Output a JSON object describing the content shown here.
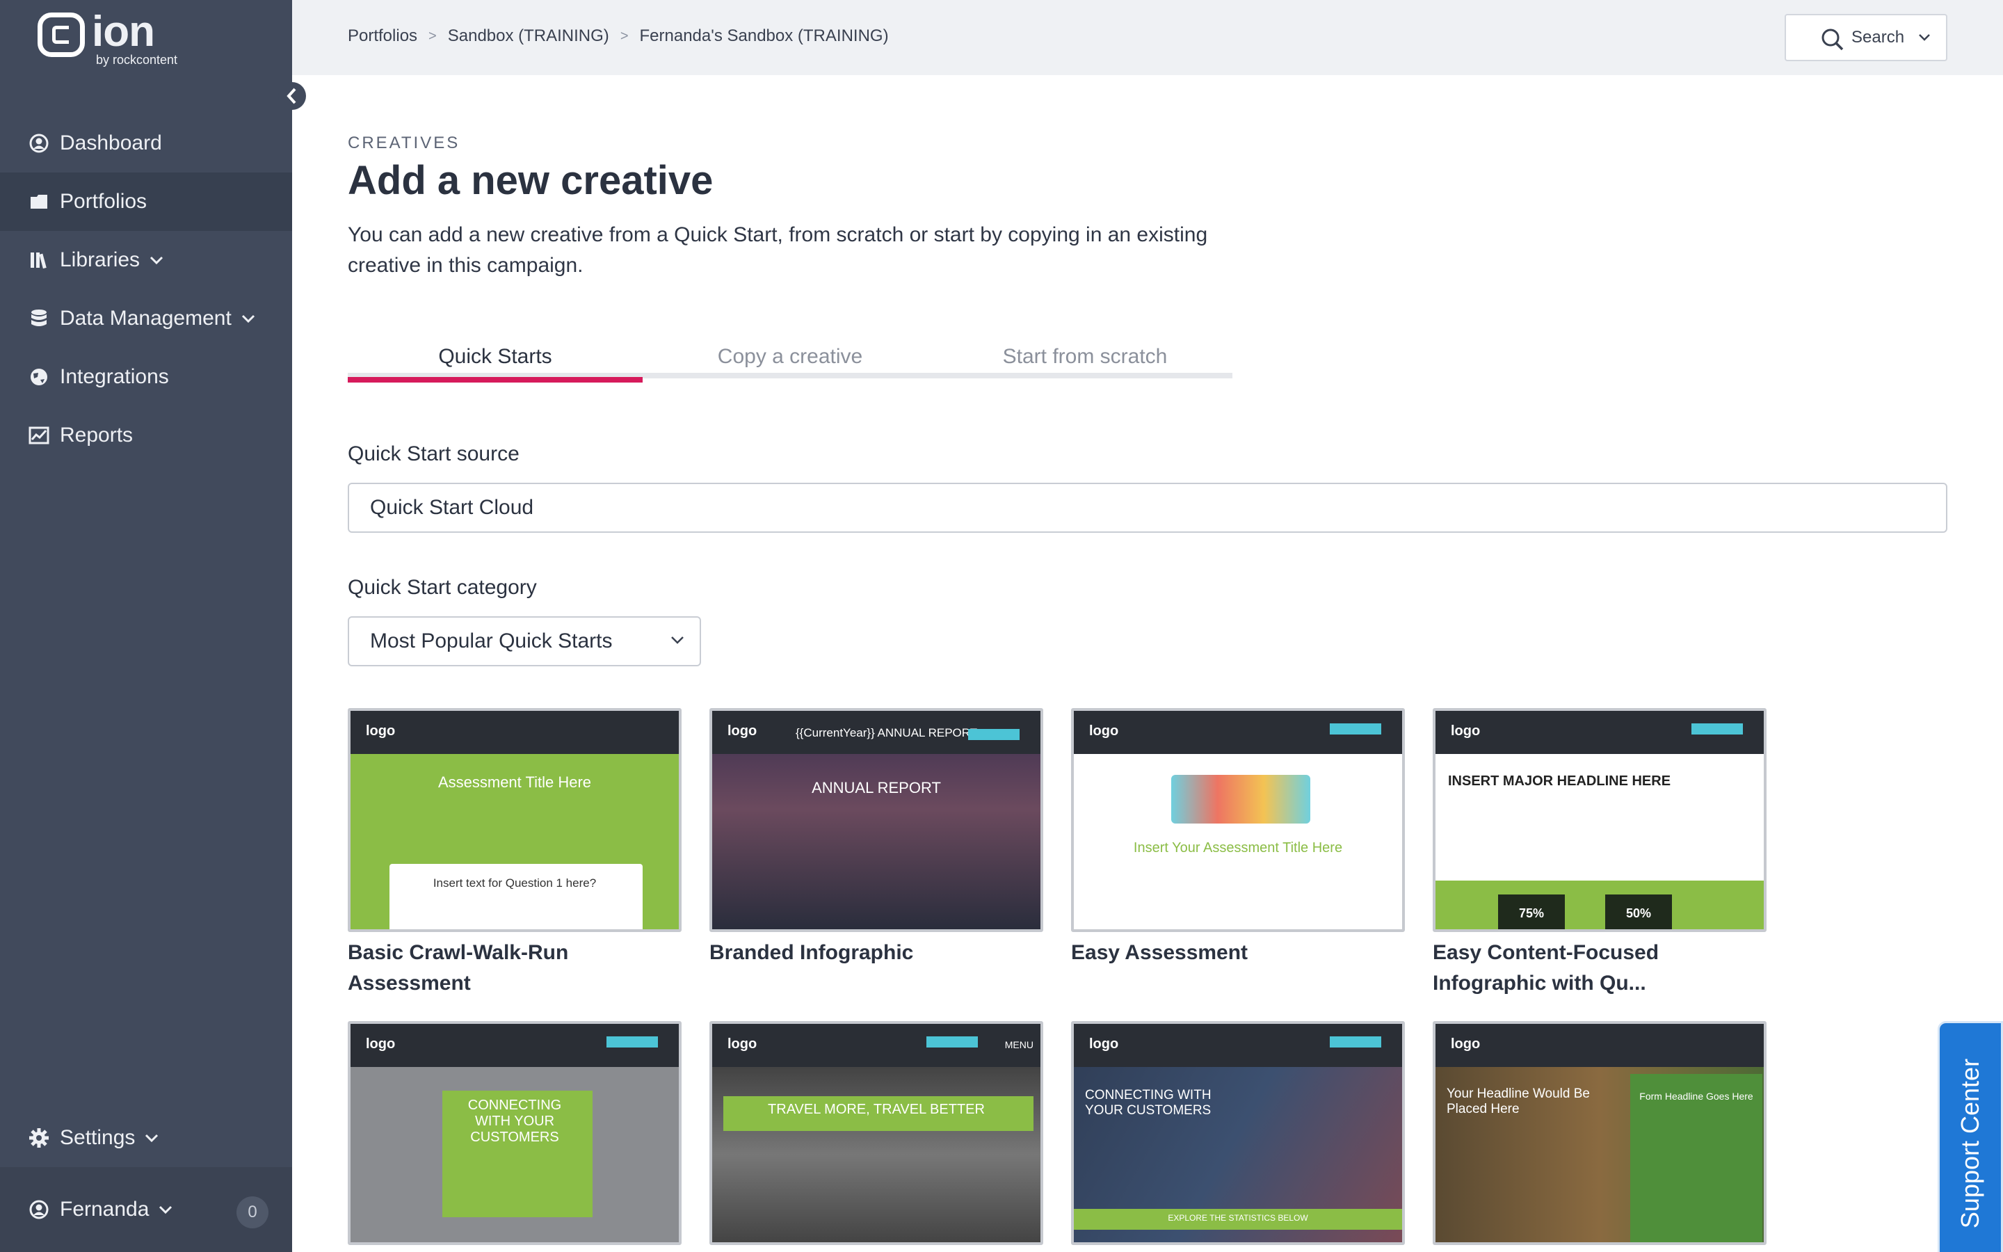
{
  "brand": {
    "name": "ion",
    "sub": "by rockcontent"
  },
  "nav": {
    "items": [
      {
        "label": "Dashboard",
        "icon": "user-circle-icon"
      },
      {
        "label": "Portfolios",
        "icon": "folder-icon"
      },
      {
        "label": "Libraries",
        "icon": "library-icon"
      },
      {
        "label": "Data Management",
        "icon": "database-icon"
      },
      {
        "label": "Integrations",
        "icon": "globe-icon"
      },
      {
        "label": "Reports",
        "icon": "chart-icon"
      }
    ],
    "settings": "Settings",
    "user": "Fernanda",
    "notifications": "0"
  },
  "breadcrumb": [
    "Portfolios",
    "Sandbox (TRAINING)",
    "Fernanda's Sandbox (TRAINING)"
  ],
  "search": {
    "label": "Search"
  },
  "page": {
    "eyebrow": "CREATIVES",
    "title": "Add a new creative",
    "description": "You can add a new creative from a Quick Start, from scratch or start by copying in an existing creative in this campaign."
  },
  "tabs": [
    "Quick Starts",
    "Copy a creative",
    "Start from scratch"
  ],
  "form": {
    "source_label": "Quick Start source",
    "source_value": "Quick Start Cloud",
    "category_label": "Quick Start category",
    "category_value": "Most Popular Quick Starts"
  },
  "cards": [
    {
      "title": "Basic Crawl-Walk-Run Assessment",
      "thumb_text": "Assessment Title Here",
      "thumb_sub": "Insert text for Question 1 here?"
    },
    {
      "title": "Branded Infographic",
      "thumb_text": "{{CurrentYear}} ANNUAL REPORT",
      "thumb_sub": "ANNUAL REPORT"
    },
    {
      "title": "Easy Assessment",
      "thumb_text": "Insert Your Assessment Title Here",
      "thumb_sub": ""
    },
    {
      "title": "Easy Content-Focused Infographic with Qu...",
      "thumb_text": "INSERT MAJOR HEADLINE HERE",
      "thumb_sub": "75%",
      "thumb_sub2": "50%"
    },
    {
      "title": "",
      "thumb_text": "CONNECTING WITH YOUR CUSTOMERS",
      "thumb_sub": ""
    },
    {
      "title": "",
      "thumb_text": "TRAVEL MORE, TRAVEL BETTER",
      "thumb_sub": "MENU"
    },
    {
      "title": "",
      "thumb_text": "CONNECTING WITH YOUR CUSTOMERS",
      "thumb_sub": "EXPLORE THE STATISTICS BELOW"
    },
    {
      "title": "",
      "thumb_text": "Your Headline Would Be Placed Here",
      "thumb_sub": "Form Headline Goes Here"
    }
  ],
  "thumb_logo": "logo",
  "support": "Support Center",
  "colors": {
    "sidebar": "#414a5c",
    "accent": "#d61a5b",
    "support": "#1f78d6",
    "thumb_green": "#8bbd46"
  }
}
